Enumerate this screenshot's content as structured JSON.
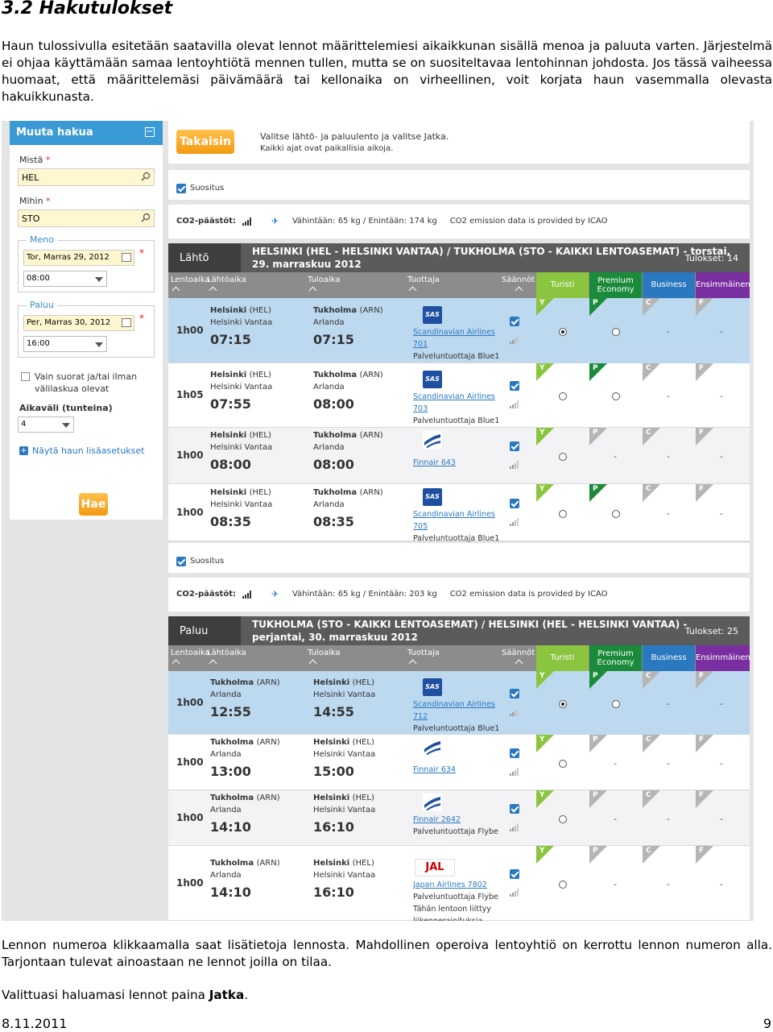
{
  "doc": {
    "heading": "3.2 Hakutulokset",
    "intro": "Haun tulossivulla esitetään saatavilla olevat lennot määrittelemiesi aikaikkunan sisällä menoa ja paluuta varten. Järjestelmä ei ohjaa käyttämään samaa lentoyhtiötä mennen tullen, mutta se on suositeltavaa lentohinnan johdosta. Jos tässä vaiheessa huomaat, että määrittelemäsi päivämäärä tai kellonaika on virheellinen, voit korjata haun vasemmalla olevasta hakuikkunasta.",
    "after1": "Lennon numeroa klikkaamalla saat lisätietoja lennosta. Mahdollinen operoiva lentoyhtiö on kerrottu lennon numeron alla. Tarjontaan tulevat ainoastaan ne lennot joilla on tilaa.",
    "after2_prefix": "Valittuasi haluamasi lennot paina ",
    "after2_bold": "Jatka",
    "after2_suffix": ".",
    "footer_date": "8.11.2011",
    "page_number": "9"
  },
  "search": {
    "title": "Muuta hakua",
    "collapse": "−",
    "from_label": "Mistä",
    "from_value": "HEL",
    "to_label": "Mihin",
    "to_value": "STO",
    "outbound_legend": "Meno",
    "outbound_date": "Tor, Marras 29, 2012",
    "outbound_time": "08:00",
    "return_legend": "Paluu",
    "return_date": "Per, Marras 30, 2012",
    "return_time": "16:00",
    "direct_line1": "Vain suorat ja/tai ilman",
    "direct_line2": "välilaskua olevat",
    "interval_label": "Aikaväli (tunteina)",
    "interval_value": "4",
    "more_settings": "Näytä haun lisäasetukset",
    "search_button": "Hae",
    "required_mark": "*"
  },
  "top": {
    "back_button": "Takaisin",
    "instruction": "Valitse lähtö- ja paluulento ja valitse Jatka.",
    "instruction_sub": "Kaikki ajat ovat paikallisia aikoja.",
    "suositus": "Suositus"
  },
  "columns": {
    "lentoaika": "Lentoaika",
    "lahtoaika": "Lähtöaika",
    "tuloaika": "Tuloaika",
    "tuottaja": "Tuottaja",
    "saannot": "Säännöt",
    "turisti": "Turisti",
    "premium_1": "Premium",
    "premium_2": "Economy",
    "business": "Business",
    "ensimmainen": "Ensimmäinen"
  },
  "outbound": {
    "co2_label": "CO2-päästöt:",
    "co2_minmax": "Vähintään: 65 kg / Enintään: 174 kg",
    "co2_source": "CO2 emission data is provided by ICAO",
    "direction": "Lähtö",
    "route_1": "HELSINKI (HEL - HELSINKI VANTAA) / TUKHOLMA (STO - KAIKKI LENTOASEMAT) - torstai,",
    "route_2": "29. marraskuu 2012",
    "count": "Tulokset: 14",
    "rows": [
      {
        "dur": "1h00",
        "dep_city": "Helsinki",
        "dep_code": "(HEL)",
        "dep_air": "Helsinki Vantaa",
        "dep_time": "07:15",
        "arr_city": "Tukholma",
        "arr_code": "(ARN)",
        "arr_air": "Arlanda",
        "arr_time": "07:15",
        "logo": "SAS",
        "link1": "Scandinavian Airlines",
        "link2": "701",
        "op": "Palveluntuottaja Blue1"
      },
      {
        "dur": "1h05",
        "dep_city": "Helsinki",
        "dep_code": "(HEL)",
        "dep_air": "Helsinki Vantaa",
        "dep_time": "07:55",
        "arr_city": "Tukholma",
        "arr_code": "(ARN)",
        "arr_air": "Arlanda",
        "arr_time": "08:00",
        "logo": "SAS",
        "link1": "Scandinavian Airlines",
        "link2": "703",
        "op": "Palveluntuottaja Blue1"
      },
      {
        "dur": "1h00",
        "dep_city": "Helsinki",
        "dep_code": "(HEL)",
        "dep_air": "Helsinki Vantaa",
        "dep_time": "08:00",
        "arr_city": "Tukholma",
        "arr_code": "(ARN)",
        "arr_air": "Arlanda",
        "arr_time": "08:00",
        "logo": "",
        "link1": "Finnair 643",
        "link2": "",
        "op": ""
      },
      {
        "dur": "1h00",
        "dep_city": "Helsinki",
        "dep_code": "(HEL)",
        "dep_air": "Helsinki Vantaa",
        "dep_time": "08:35",
        "arr_city": "Tukholma",
        "arr_code": "(ARN)",
        "arr_air": "Arlanda",
        "arr_time": "08:35",
        "logo": "SAS",
        "link1": "Scandinavian Airlines",
        "link2": "705",
        "op": "Palveluntuottaja Blue1"
      }
    ]
  },
  "return": {
    "co2_label": "CO2-päästöt:",
    "co2_minmax": "Vähintään: 65 kg / Enintään: 203 kg",
    "co2_source": "CO2 emission data is provided by ICAO",
    "direction": "Paluu",
    "route_1": "TUKHOLMA (STO - KAIKKI LENTOASEMAT) / HELSINKI (HEL - HELSINKI VANTAA) -",
    "route_2": "perjantai, 30. marraskuu 2012",
    "count": "Tulokset: 25",
    "rows": [
      {
        "dur": "1h00",
        "dep_city": "Tukholma",
        "dep_code": "(ARN)",
        "dep_air": "Arlanda",
        "dep_time": "12:55",
        "arr_city": "Helsinki",
        "arr_code": "(HEL)",
        "arr_air": "Helsinki Vantaa",
        "arr_time": "14:55",
        "logo": "SAS",
        "link1": "Scandinavian Airlines",
        "link2": "712",
        "op": "Palveluntuottaja Blue1"
      },
      {
        "dur": "1h00",
        "dep_city": "Tukholma",
        "dep_code": "(ARN)",
        "dep_air": "Arlanda",
        "dep_time": "13:00",
        "arr_city": "Helsinki",
        "arr_code": "(HEL)",
        "arr_air": "Helsinki Vantaa",
        "arr_time": "15:00",
        "logo": "",
        "link1": "Finnair 634",
        "link2": "",
        "op": ""
      },
      {
        "dur": "1h00",
        "dep_city": "Tukholma",
        "dep_code": "(ARN)",
        "dep_air": "Arlanda",
        "dep_time": "14:10",
        "arr_city": "Helsinki",
        "arr_code": "(HEL)",
        "arr_air": "Helsinki Vantaa",
        "arr_time": "16:10",
        "logo": "",
        "link1": "Finnair 2642",
        "link2": "",
        "op": "Palveluntuottaja Flybe"
      },
      {
        "dur": "1h00",
        "dep_city": "Tukholma",
        "dep_code": "(ARN)",
        "dep_air": "Arlanda",
        "dep_time": "14:10",
        "arr_city": "Helsinki",
        "arr_code": "(HEL)",
        "arr_air": "Helsinki Vantaa",
        "arr_time": "16:10",
        "logo": "JAL",
        "link1": "Japan Airlines 7802",
        "link2": "",
        "op": "Palveluntuottaja Flybe",
        "note1": "Tähän lentoon liittyy",
        "note2": "liikennerajoituksia."
      }
    ]
  },
  "class_flags": [
    "Y",
    "P",
    "C",
    "F"
  ],
  "colors": {
    "turisti": "#8bc53f",
    "premium": "#1b8a3a",
    "business": "#2a78c0",
    "ensimmainen": "#7a2fa0",
    "inactive_flag": "#b5b5b5",
    "selected_row": "#bcd9f0",
    "accent_orange": "#f39a12"
  }
}
